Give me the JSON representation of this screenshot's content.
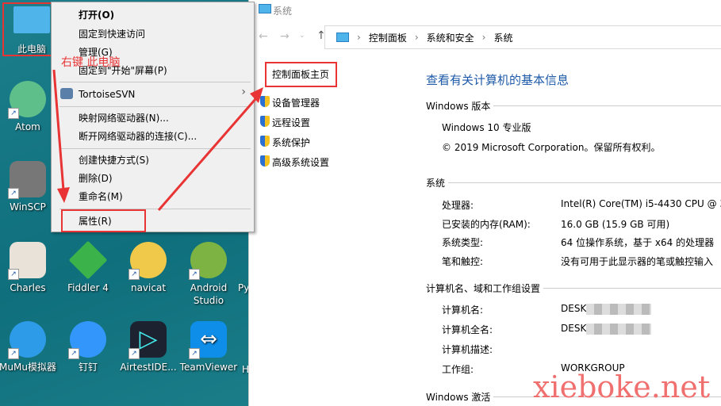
{
  "desktop": {
    "icons": [
      {
        "label": "此电脑",
        "color": "#4fb4ea"
      },
      {
        "label": "Atom",
        "color": "#5fbf8a"
      },
      {
        "label": "WinSCP",
        "color": "#777777"
      },
      {
        "label": "Charles",
        "color": "#e8e2d8"
      },
      {
        "label": "Fiddler 4",
        "color": "#3bb34a"
      },
      {
        "label": "navicat",
        "color": "#f0c84a"
      },
      {
        "label": "Android Studio",
        "color": "#7cb342"
      },
      {
        "label": "Py",
        "color": "#3a76a8"
      },
      {
        "label": "MuMu模拟器",
        "color": "#2e9be8"
      },
      {
        "label": "钉钉",
        "color": "#3296fa"
      },
      {
        "label": "AirtestIDE...",
        "color": "#1c2230"
      },
      {
        "label": "TeamViewer",
        "color": "#0e8ee9"
      },
      {
        "label": "H",
        "color": "#888888"
      }
    ]
  },
  "context_menu": {
    "items": [
      "打开(O)",
      "固定到快速访问",
      "管理(G)",
      "固定到\"开始\"屏幕(P)",
      "TortoiseSVN",
      "映射网络驱动器(N)...",
      "断开网络驱动器的连接(C)...",
      "创建快捷方式(S)",
      "删除(D)",
      "重命名(M)",
      "属性(R)"
    ]
  },
  "annotation": {
    "text": "右键 此电脑",
    "watermark": "xieboke.net",
    "color": "#e83434"
  },
  "window": {
    "title": "系统",
    "breadcrumb": [
      "控制面板",
      "系统和安全",
      "系统"
    ],
    "nav": {
      "home": "控制面板主页",
      "links": [
        "设备管理器",
        "远程设置",
        "系统保护",
        "高级系统设置"
      ]
    },
    "heading": "查看有关计算机的基本信息",
    "sections": {
      "edition": {
        "title": "Windows 版本",
        "name": "Windows 10 专业版",
        "copyright": "© 2019 Microsoft Corporation。保留所有权利。"
      },
      "system": {
        "title": "系统",
        "rows": [
          [
            "处理器:",
            "Intel(R) Core(TM) i5-4430 CPU @ 3"
          ],
          [
            "已安装的内存(RAM):",
            "16.0 GB (15.9 GB 可用)"
          ],
          [
            "系统类型:",
            "64 位操作系统，基于 x64 的处理器"
          ],
          [
            "笔和触控:",
            "没有可用于此显示器的笔或触控输入"
          ]
        ]
      },
      "computer": {
        "title": "计算机名、域和工作组设置",
        "rows": [
          [
            "计算机名:",
            "DESK"
          ],
          [
            "计算机全名:",
            "DESK"
          ],
          [
            "计算机描述:",
            ""
          ],
          [
            "工作组:",
            "WORKGROUP"
          ]
        ]
      },
      "activation": {
        "title": "Windows 激活"
      }
    }
  }
}
